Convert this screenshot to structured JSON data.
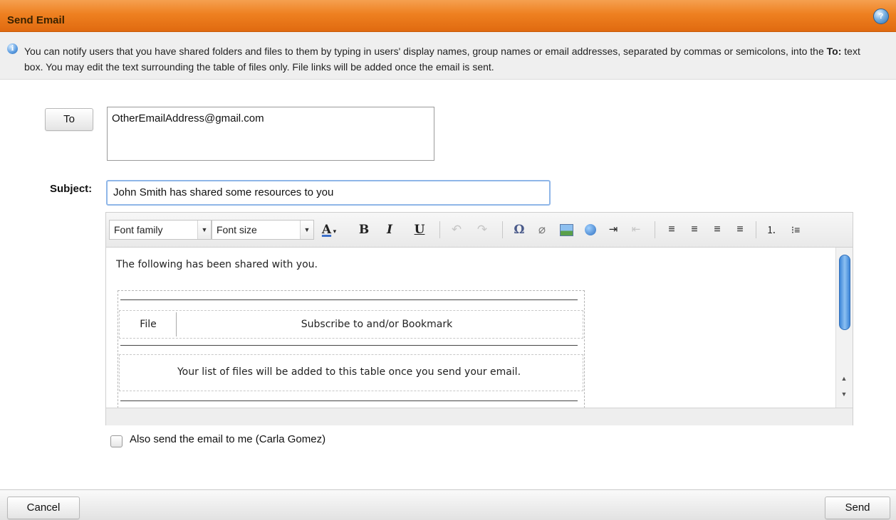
{
  "dialog": {
    "title": "Send Email"
  },
  "info": {
    "text_part1": "You can notify users that you have shared folders and files to them by typing in users' display names, group names or email addresses, separated by commas or semicolons, into the ",
    "text_bold": "To:",
    "text_part2": " text box. You may edit the text surrounding the table of files only. File links will be added once the email is sent."
  },
  "form": {
    "to_button_label": "To",
    "to_value": "OtherEmailAddress@gmail.com",
    "subject_label": "Subject:",
    "subject_value": "John Smith has shared some resources to you"
  },
  "editor": {
    "font_family_placeholder": "Font family",
    "font_size_placeholder": "Font size",
    "toolbar_icons": [
      "font-color",
      "bold",
      "italic",
      "underline",
      "undo",
      "redo",
      "special-character",
      "remove-format",
      "insert-image",
      "insert-link",
      "indent",
      "outdent",
      "align-left",
      "align-center",
      "align-right",
      "align-justify",
      "numbered-list",
      "bulleted-list"
    ],
    "intro_text": "The following has been shared with you.",
    "table": {
      "col1": "File",
      "col2": "Subscribe to and/or Bookmark",
      "placeholder_row": "Your list of files will be added to this table once you send your email."
    }
  },
  "options": {
    "cc_me_label": "Also send the email to me (Carla Gomez)",
    "cc_me_checked": false
  },
  "footer": {
    "cancel_label": "Cancel",
    "send_label": "Send"
  },
  "colors": {
    "titlebar": "#ee8020",
    "accent_blue": "#3d86d8"
  }
}
